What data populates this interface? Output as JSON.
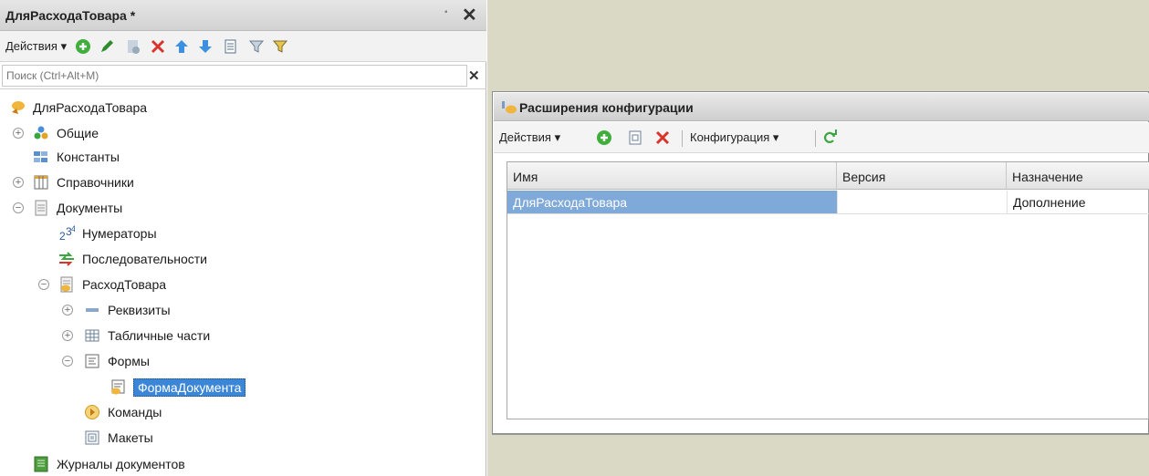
{
  "left_panel": {
    "title": "ДляРасходаТовара *",
    "actions_label": "Действия",
    "search_placeholder": "Поиск (Ctrl+Alt+M)",
    "tree": [
      {
        "label": "ДляРасходаТовара",
        "icon": "config-extension-icon"
      },
      {
        "label": "Общие",
        "icon": "common-icon"
      },
      {
        "label": "Константы",
        "icon": "constants-icon"
      },
      {
        "label": "Справочники",
        "icon": "catalogs-icon"
      },
      {
        "label": "Документы",
        "icon": "documents-icon"
      },
      {
        "label": "Нумераторы",
        "icon": "numerators-icon"
      },
      {
        "label": "Последовательности",
        "icon": "sequences-icon"
      },
      {
        "label": "РасходТовара",
        "icon": "document-icon"
      },
      {
        "label": "Реквизиты",
        "icon": "attributes-icon"
      },
      {
        "label": "Табличные части",
        "icon": "tabular-sections-icon"
      },
      {
        "label": "Формы",
        "icon": "forms-icon"
      },
      {
        "label": "ФормаДокумента",
        "icon": "form-icon"
      },
      {
        "label": "Команды",
        "icon": "commands-icon"
      },
      {
        "label": "Макеты",
        "icon": "templates-icon"
      },
      {
        "label": "Журналы документов",
        "icon": "document-journals-icon"
      }
    ]
  },
  "extensions_window": {
    "title": "Расширения конфигурации",
    "actions_label": "Действия",
    "configuration_label": "Конфигурация",
    "columns": [
      "Имя",
      "Версия",
      "Назначение"
    ],
    "rows": [
      {
        "name": "ДляРасходаТовара",
        "version": "",
        "purpose": "Дополнение"
      }
    ]
  },
  "colors": {
    "selection": "#3c86d8",
    "workspace_bg": "#d9d9c6"
  }
}
